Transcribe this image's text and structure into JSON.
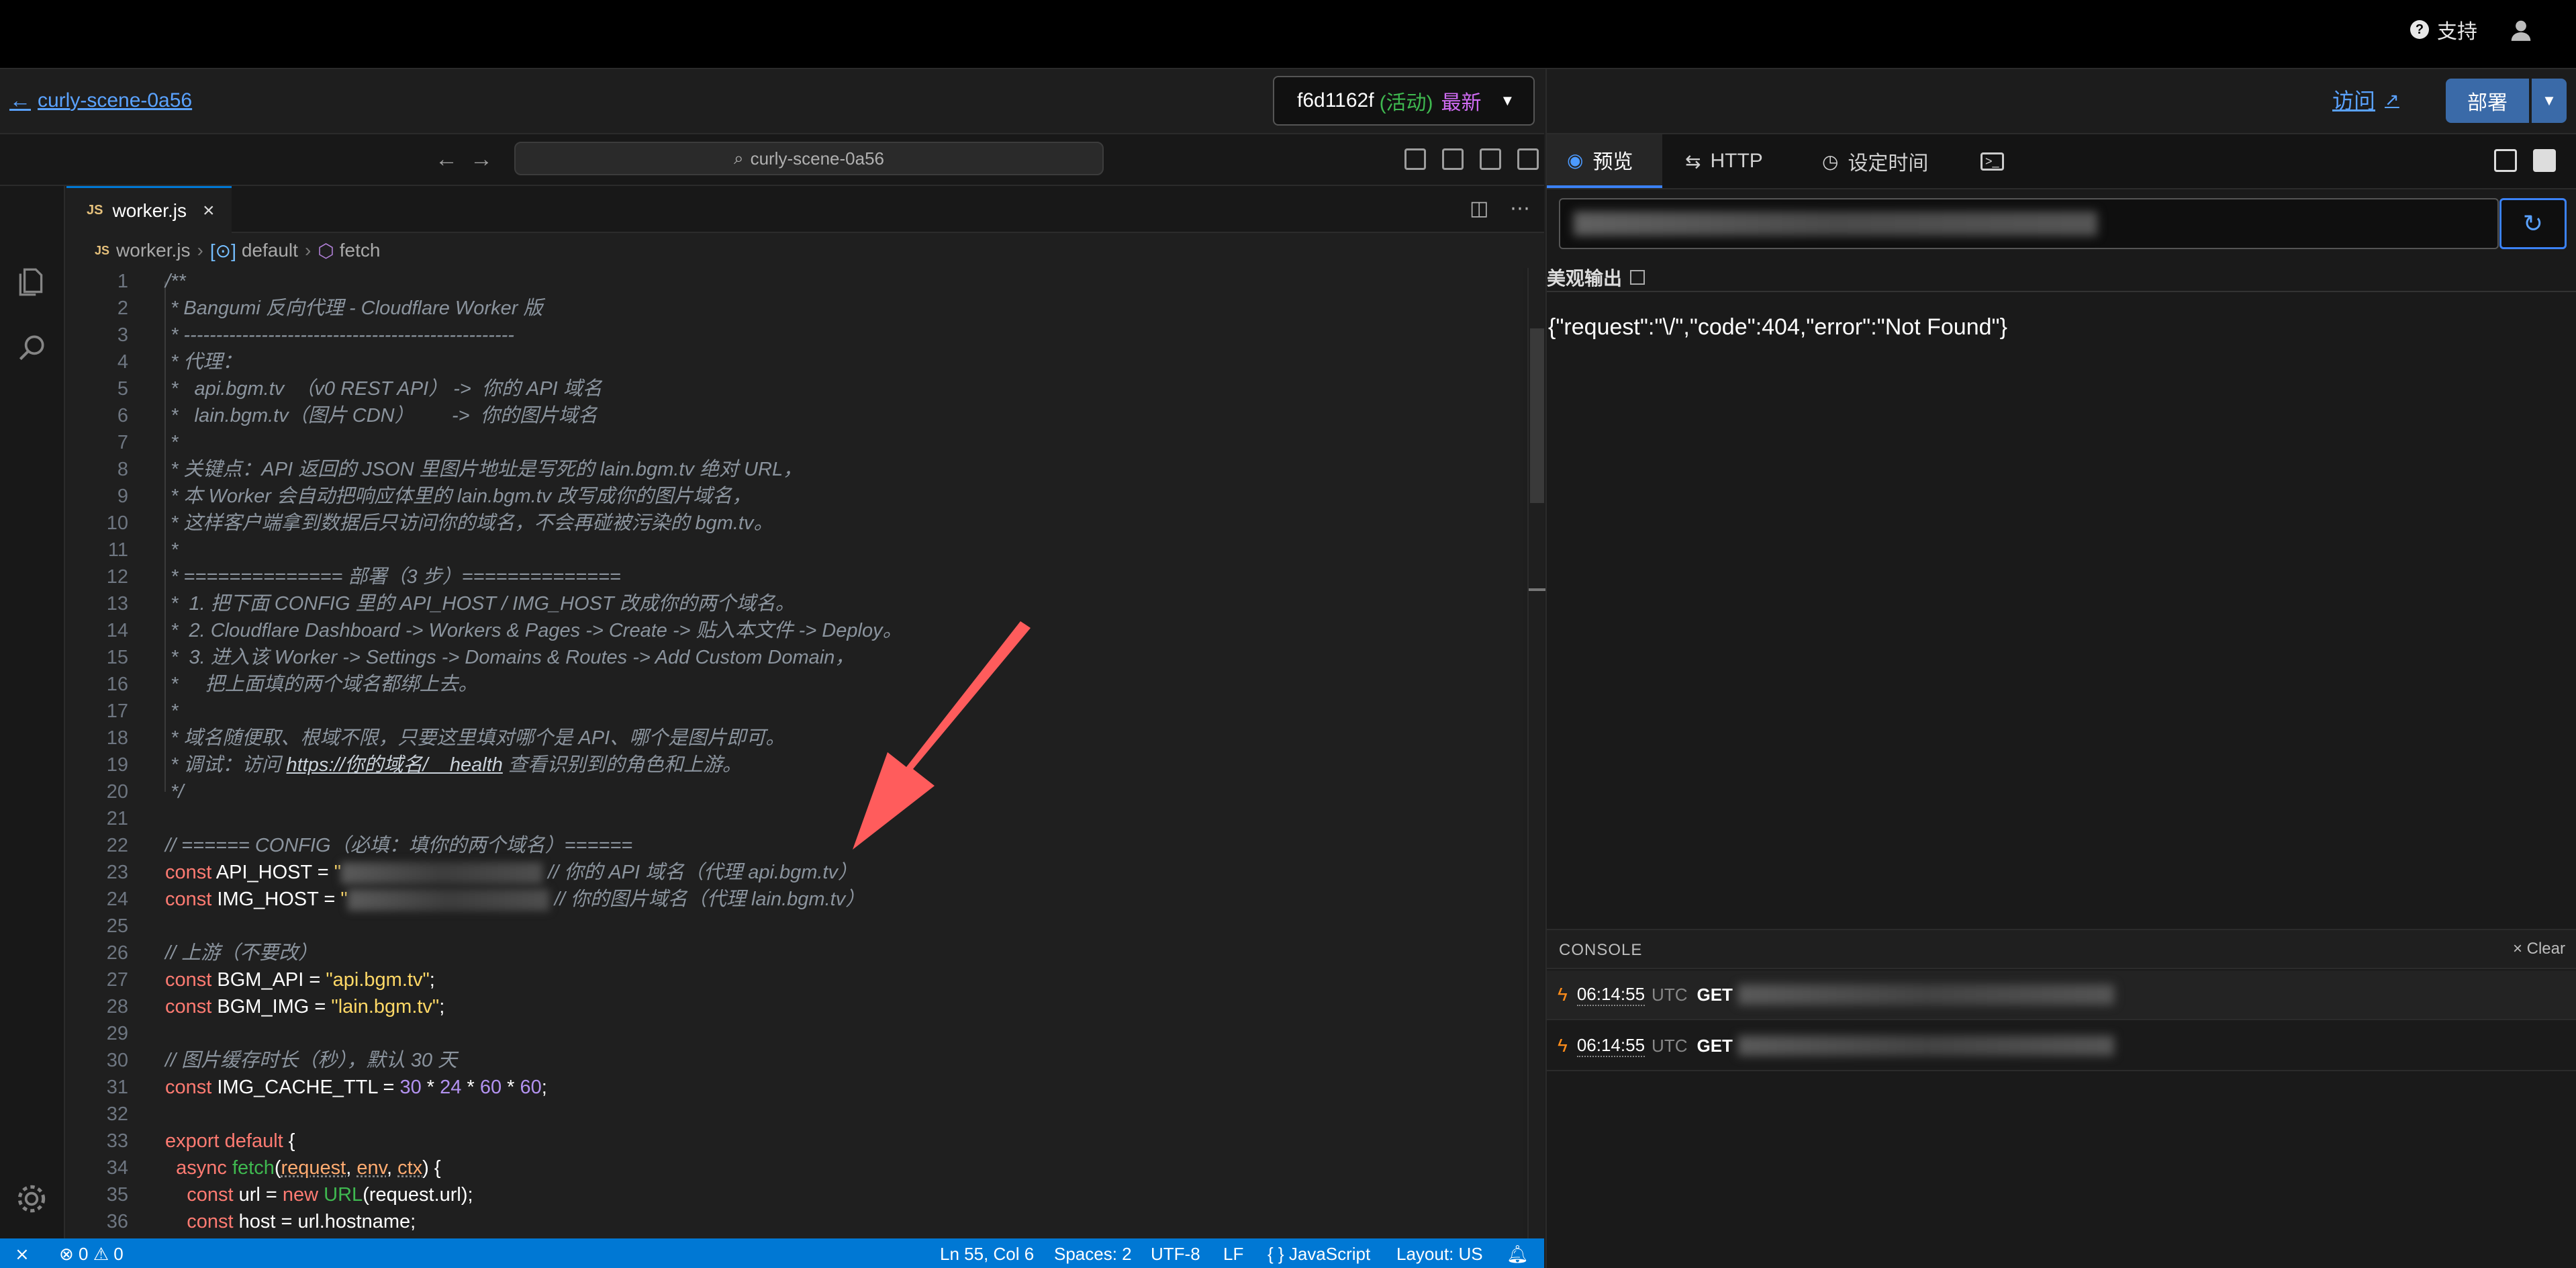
{
  "topbar": {
    "support_label": "支持"
  },
  "project": {
    "name": "curly-scene-0a56"
  },
  "branch": {
    "commit": "f6d1162f",
    "active_label": "(活动)",
    "latest_label": "最新"
  },
  "vscode": {
    "command_center": "curly-scene-0a56",
    "tab_file": "worker.js",
    "tab_badge": "JS",
    "breadcrumbs": [
      "worker.js",
      "default",
      "fetch"
    ]
  },
  "code_lines": [
    "/**",
    " * Bangumi 反向代理 - Cloudflare Worker 版",
    " * ---------------------------------------------------",
    " * 代理：",
    " *   api.bgm.tv  （v0 REST API） ->  你的 API 域名",
    " *   lain.bgm.tv（图片 CDN）       ->  你的图片域名",
    " *",
    " * 关键点：API 返回的 JSON 里图片地址是写死的 lain.bgm.tv 绝对 URL，",
    " * 本 Worker 会自动把响应体里的 lain.bgm.tv 改写成你的图片域名，",
    " * 这样客户端拿到数据后只访问你的域名，不会再碰被污染的 bgm.tv。",
    " *",
    " * ============== 部署（3 步）==============",
    " *  1. 把下面 CONFIG 里的 API_HOST / IMG_HOST 改成你的两个域名。",
    " *  2. Cloudflare Dashboard -> Workers & Pages -> Create -> 贴入本文件 -> Deploy。",
    " *  3. 进入该 Worker -> Settings -> Domains & Routes -> Add Custom Domain，",
    " *     把上面填的两个域名都绑上去。",
    " *",
    " * 域名随便取、根域不限，只要这里填对哪个是 API、哪个是图片即可。",
    " * 调试：访问",
    " */",
    "",
    "// ====== CONFIG（必填：填你的两个域名）======",
    "const API_HOST = \"",
    "const IMG_HOST = \"",
    "",
    "// 上游（不要改）",
    "const BGM_API = \"api.bgm.tv\";",
    "const BGM_IMG = \"lain.bgm.tv\";",
    "",
    "// 图片缓存时长（秒），默认 30 天",
    "const IMG_CACHE_TTL = 30 * 24 * 60 * 60;",
    "",
    "export default {",
    "  async fetch(request, env, ctx) {",
    "    const url = new URL(request.url);",
    "    const host = url.hostname;"
  ],
  "code_extra": {
    "debug_link": "https://你的域名/__health",
    "debug_tail": "查看识别到的角色和上游。",
    "api_host_comment": "// 你的 API 域名（代理 api.bgm.tv）",
    "img_host_comment": "// 你的图片域名（代理 lain.bgm.tv）"
  },
  "statusbar": {
    "problems": "⊗ 0 ⚠ 0",
    "position": "Ln 55, Col 6",
    "spaces": "Spaces: 2",
    "encoding": "UTF-8",
    "eol": "LF",
    "language": "{ } JavaScript",
    "layout": "Layout: US"
  },
  "preview": {
    "visit_label": "访问",
    "deploy_label": "部署",
    "tabs": [
      "预览",
      "HTTP",
      "设定时间"
    ],
    "pretty_label": "美观输出",
    "response": "{\"request\":\"\\/\",\"code\":404,\"error\":\"Not Found\"}"
  },
  "console": {
    "title": "CONSOLE",
    "clear_label": "Clear",
    "rows": [
      {
        "time": "06:14:55",
        "tz": "UTC",
        "method": "GET"
      },
      {
        "time": "06:14:55",
        "tz": "UTC",
        "method": "GET"
      }
    ]
  },
  "colors": {
    "accent": "#0078d4",
    "link": "#5aa2ff",
    "deploy": "#3a6aa8",
    "active": "#3fb950",
    "latest": "#d16cf5",
    "arrow": "#ff5c5c"
  }
}
